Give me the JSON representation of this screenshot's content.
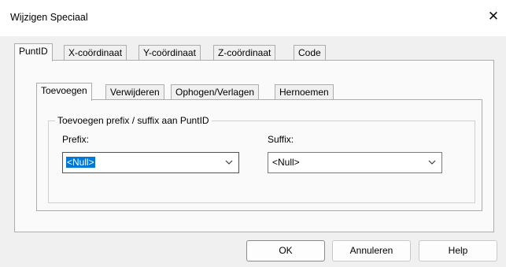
{
  "window": {
    "title": "Wijzigen Speciaal",
    "close_glyph": "✕"
  },
  "outer_tabs": [
    "PuntID",
    "X-coördinaat",
    "Y-coördinaat",
    "Z-coördinaat",
    "Code"
  ],
  "outer_active": "PuntID",
  "inner_tabs": [
    "Toevoegen",
    "Verwijderen",
    "Ophogen/Verlagen",
    "Hernoemen"
  ],
  "inner_active": "Toevoegen",
  "group": {
    "legend": "Toevoegen prefix / suffix aan PuntID",
    "prefix": {
      "label": "Prefix:",
      "value": "<Null>"
    },
    "suffix": {
      "label": "Suffix:",
      "value": "<Null>"
    }
  },
  "buttons": {
    "ok": "OK",
    "cancel": "Annuleren",
    "help": "Help"
  },
  "colors": {
    "accent": "#0078d7",
    "focus_border": "#0b62c4"
  }
}
